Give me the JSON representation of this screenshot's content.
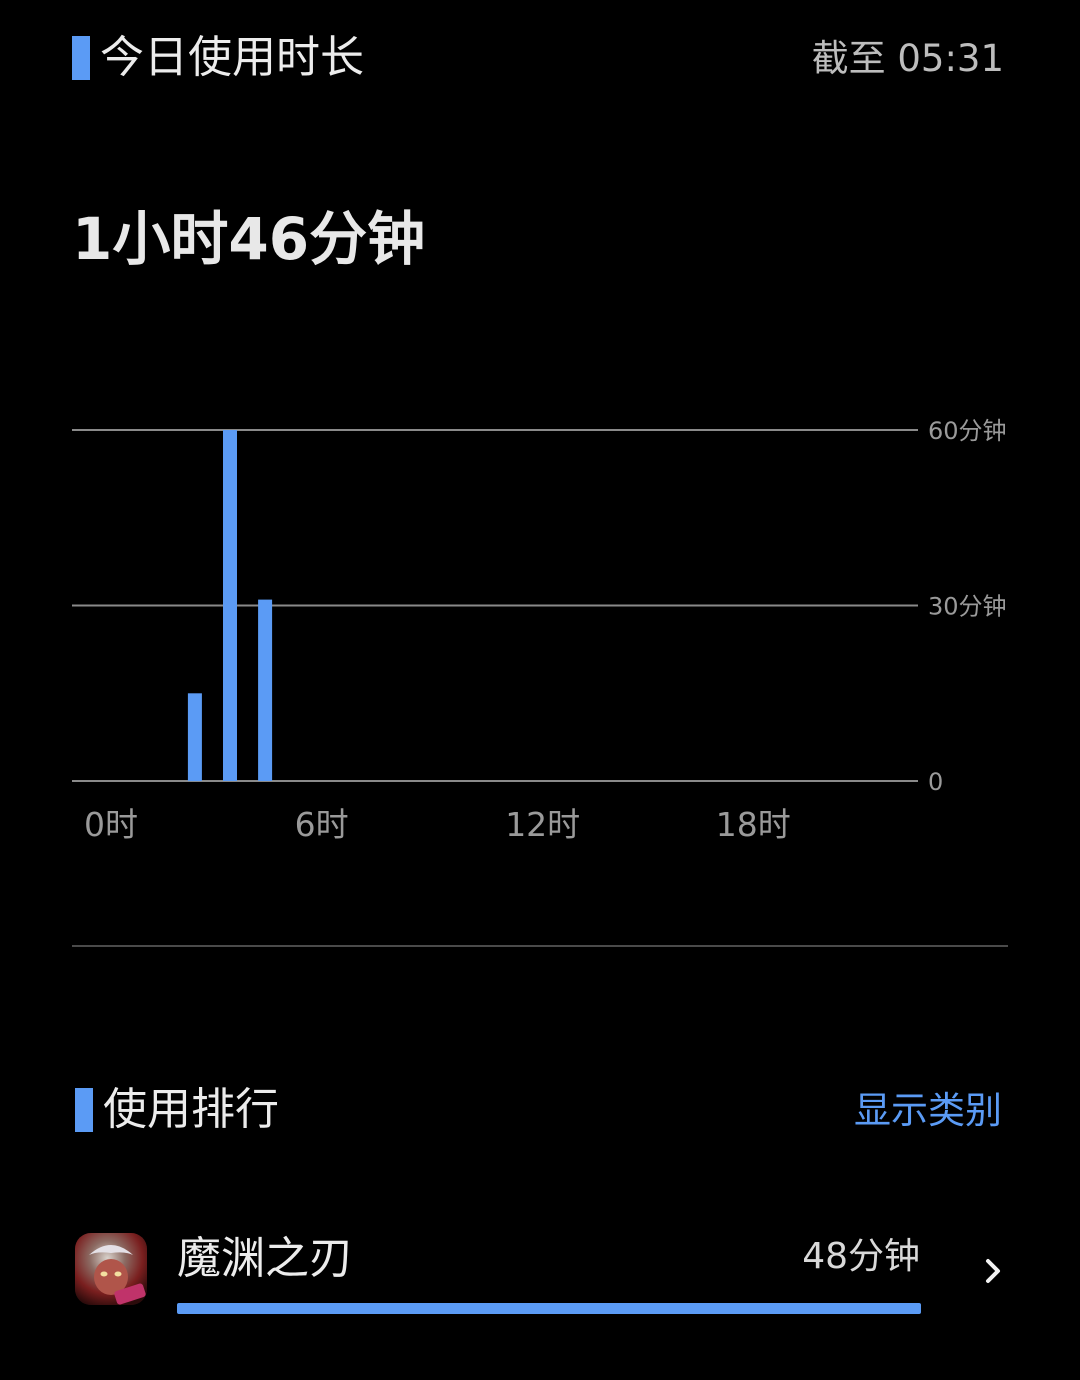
{
  "header": {
    "title": "今日使用时长",
    "as_of": "截至 05:31"
  },
  "summary": {
    "total_duration": "1小时46分钟"
  },
  "colors": {
    "accent": "#5b9bf5",
    "background": "#000000",
    "gridline": "#8a8a8a",
    "tick_text": "#9a9a9a"
  },
  "chart_data": {
    "type": "bar",
    "x": [
      0,
      1,
      2,
      3,
      4,
      5,
      6,
      7,
      8,
      9,
      10,
      11,
      12,
      13,
      14,
      15,
      16,
      17,
      18,
      19,
      20,
      21,
      22,
      23
    ],
    "values": [
      0,
      0,
      0,
      15,
      60,
      31,
      0,
      0,
      0,
      0,
      0,
      0,
      0,
      0,
      0,
      0,
      0,
      0,
      0,
      0,
      0,
      0,
      0,
      0
    ],
    "x_ticks": [
      {
        "value": 0,
        "label": "0时"
      },
      {
        "value": 6,
        "label": "6时"
      },
      {
        "value": 12,
        "label": "12时"
      },
      {
        "value": 18,
        "label": "18时"
      }
    ],
    "y_ticks": [
      {
        "value": 0,
        "label": "0"
      },
      {
        "value": 30,
        "label": "30分钟"
      },
      {
        "value": 60,
        "label": "60分钟"
      }
    ],
    "ylim": [
      0,
      60
    ],
    "grid": true
  },
  "ranking": {
    "title": "使用排行",
    "show_category_label": "显示类别",
    "items": [
      {
        "name": "魔渊之刃",
        "duration": "48分钟",
        "share": 1.0,
        "icon": "game-app-icon"
      }
    ]
  }
}
